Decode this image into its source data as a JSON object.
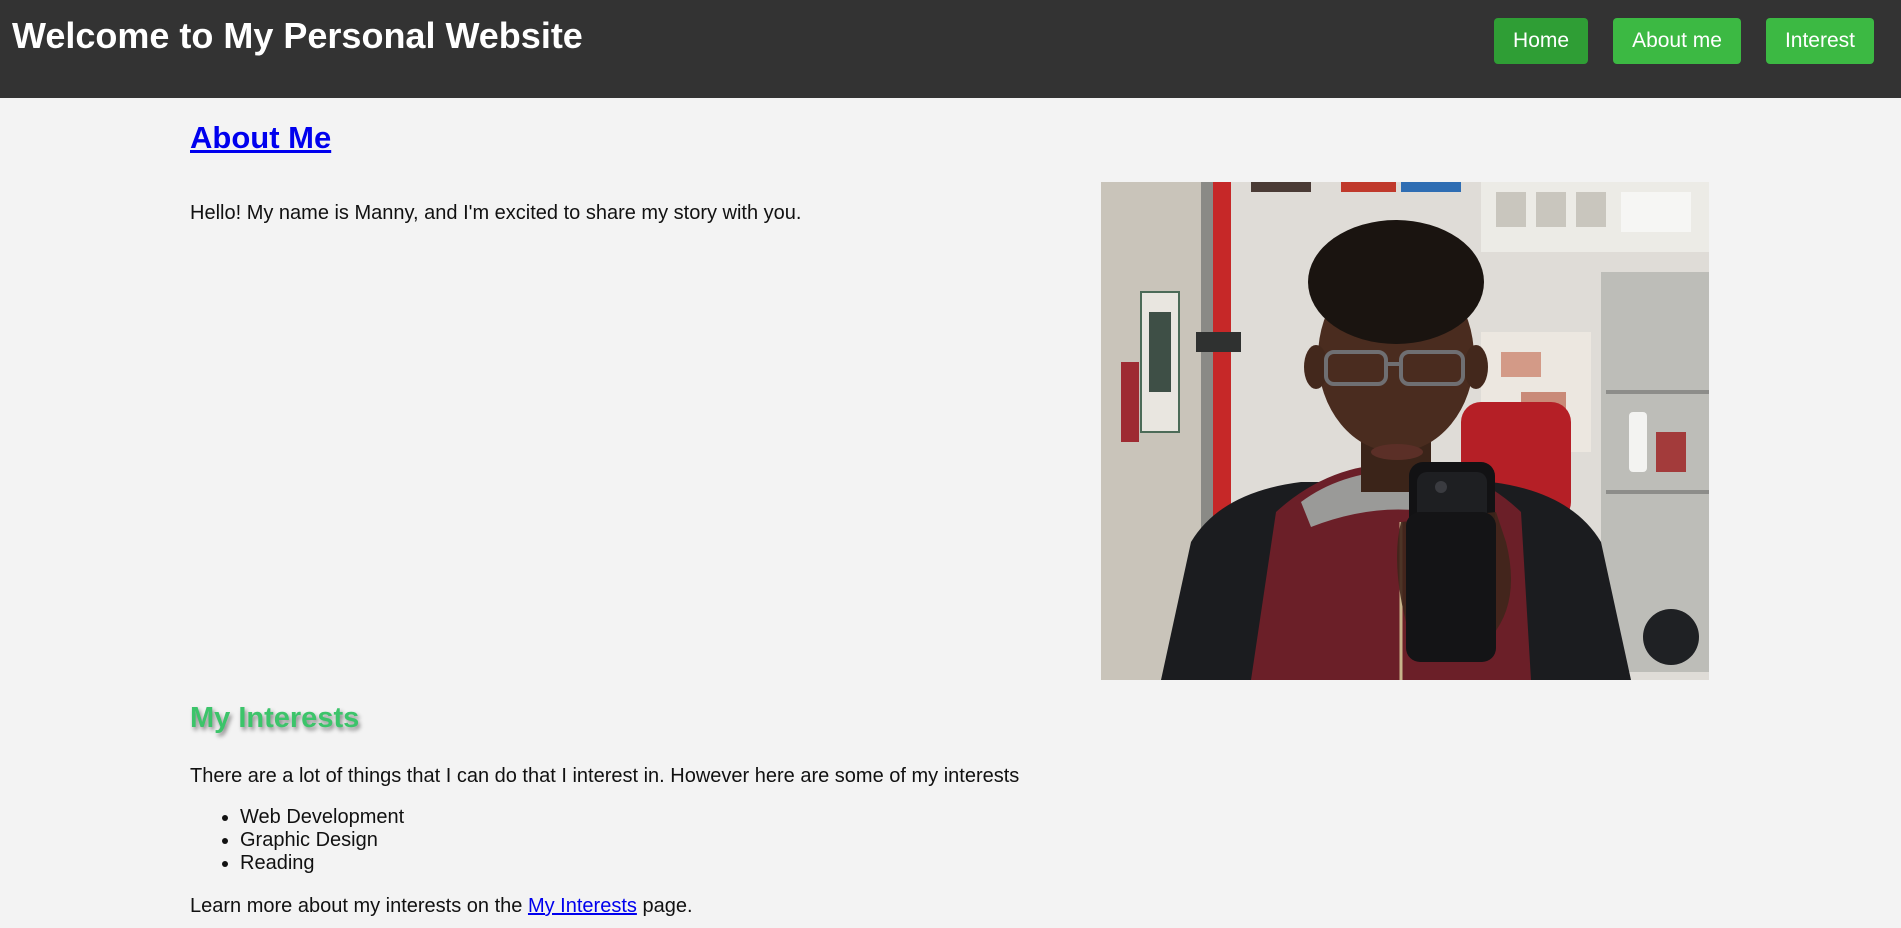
{
  "header": {
    "title": "Welcome to My Personal Website",
    "nav": [
      {
        "label": "Home"
      },
      {
        "label": "About me"
      },
      {
        "label": "Interest"
      }
    ]
  },
  "about": {
    "heading": "About Me",
    "intro": "Hello! My name is Manny, and I'm excited to share my story with you."
  },
  "interests": {
    "heading": "My Interests",
    "text": "There are a lot of things that I can do that I interest in. However here are some of my interests",
    "items": [
      "Web Development",
      "Graphic Design",
      "Reading"
    ],
    "learn_more_prefix": "Learn more about my interests on the ",
    "learn_more_link": "My Interests",
    "learn_more_suffix": " page."
  },
  "colors": {
    "header_bg": "#333333",
    "nav_button": "#3cb943",
    "nav_button_active": "#2f9e35",
    "page_bg": "#f3f3f3",
    "link": "#0000ee",
    "interests_heading": "#3cc46a"
  }
}
